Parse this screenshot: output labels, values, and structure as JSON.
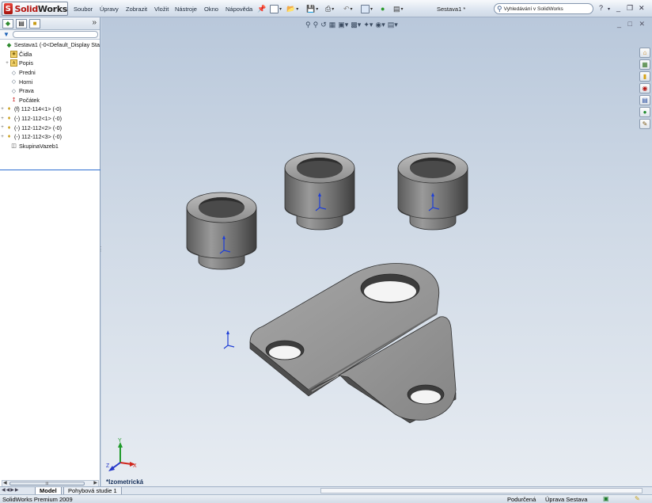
{
  "app": {
    "logo_mark": "S",
    "logo_text_a": "Solid",
    "logo_text_b": "Works",
    "document_title": "Sestava1 *"
  },
  "menu": [
    "Soubor",
    "Úpravy",
    "Zobrazit",
    "Vložit",
    "Nástroje",
    "Okno",
    "Nápověda"
  ],
  "search": {
    "label": "Vyhledávání v SolidWorks"
  },
  "window_controls": {
    "help": "?",
    "min": "_",
    "restore": "❐",
    "close": "✕"
  },
  "panel": {
    "expand": "»",
    "tree": [
      {
        "label": "Sestava1  (-0<Default_Display Sta",
        "icon": "assembly-icon",
        "plus": ""
      },
      {
        "label": "Čidla",
        "icon": "sensor-folder-icon",
        "plus": ""
      },
      {
        "label": "Popis",
        "icon": "annotation-folder-icon",
        "plus": "+"
      },
      {
        "label": "Predni",
        "icon": "plane-icon",
        "plus": ""
      },
      {
        "label": "Horni",
        "icon": "plane-icon",
        "plus": ""
      },
      {
        "label": "Prava",
        "icon": "plane-icon",
        "plus": ""
      },
      {
        "label": "Počátek",
        "icon": "origin-icon",
        "plus": ""
      },
      {
        "label": "(f) 112-114<1> (-0)",
        "icon": "part-icon",
        "plus": "+"
      },
      {
        "label": "(-) 112-112<1> (-0)",
        "icon": "part-icon",
        "plus": "+"
      },
      {
        "label": "(-) 112-112<2> (-0)",
        "icon": "part-icon",
        "plus": "+"
      },
      {
        "label": "(-) 112-112<3> (-0)",
        "icon": "part-icon",
        "plus": "+"
      },
      {
        "label": "SkupinaVazeb1",
        "icon": "mates-icon",
        "plus": ""
      }
    ],
    "scroll_label": "III"
  },
  "viewport": {
    "view_name": "*Izometrická",
    "axis_x": "X",
    "axis_y": "Y",
    "axis_z": "Z"
  },
  "tabs": [
    {
      "label": "Model",
      "active": true
    },
    {
      "label": "Pohybová studie 1",
      "active": false
    }
  ],
  "status": {
    "product": "SolidWorks Premium 2009",
    "state": "Podurčená",
    "mode": "Úprava Sestava"
  },
  "colors": {
    "part_face": "#8e8e8e",
    "part_dark": "#4e4e4e",
    "part_light": "#c4c4c4",
    "selection_blue": "#1f3fd6",
    "brand_red": "#b51510"
  }
}
